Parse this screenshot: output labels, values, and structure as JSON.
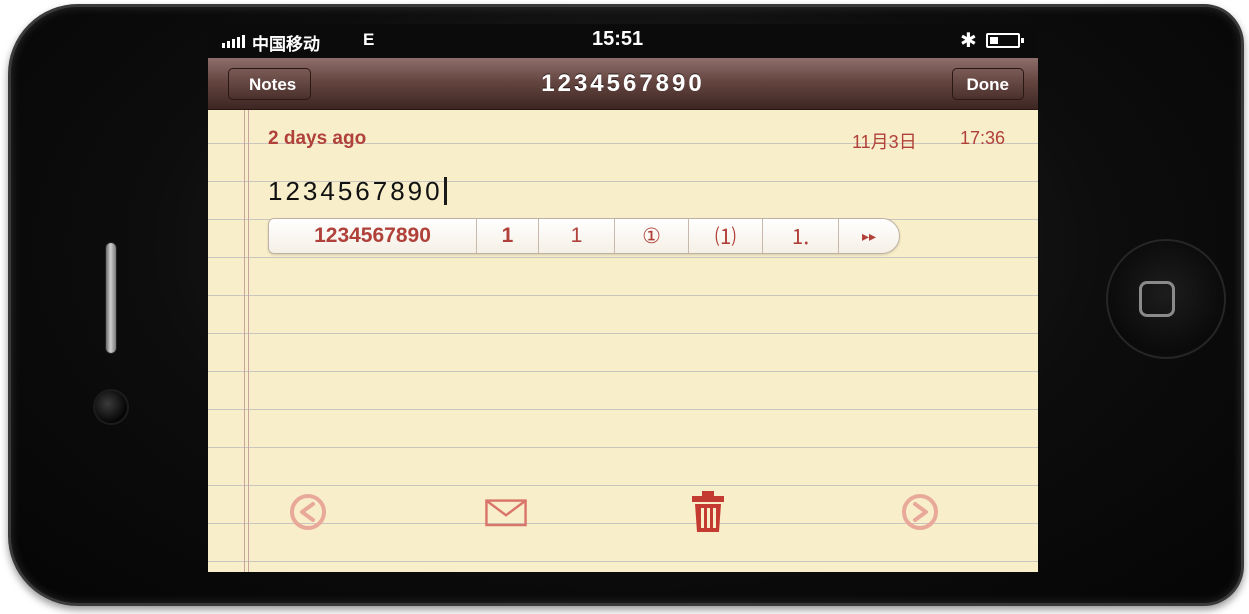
{
  "status_bar": {
    "carrier": "中国移动",
    "network": "E",
    "time": "15:51",
    "bluetooth_icon": "bluetooth-icon",
    "battery_level": 0.3
  },
  "nav": {
    "back_label": "Notes",
    "title": "1234567890",
    "done_label": "Done"
  },
  "note": {
    "relative_date": "2 days ago",
    "date": "11月3日",
    "time": "17:36",
    "text": "1234567890"
  },
  "detector": {
    "options": [
      "1234567890",
      "1",
      "1",
      "①",
      "⑴",
      "⒈"
    ],
    "more_icon": "more-arrow-icon"
  },
  "toolbar": {
    "icons": [
      "previous-arrow-icon",
      "mail-icon",
      "trash-icon",
      "next-arrow-icon"
    ]
  },
  "colors": {
    "accent": "#b0403a",
    "paper": "#f8eec9",
    "nav": "#654641"
  }
}
